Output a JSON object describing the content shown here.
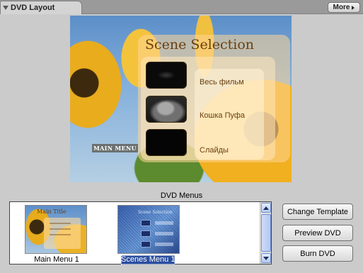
{
  "panel": {
    "title": "DVD Layout",
    "more_label": "More"
  },
  "preview": {
    "scene_title": "Scene Selection",
    "items": [
      {
        "label": "Весь фильм"
      },
      {
        "label": "Кошка Пуфа"
      },
      {
        "label": "Слайды"
      }
    ],
    "main_menu_label": "MAIN MENU"
  },
  "menus": {
    "heading": "DVD Menus",
    "items": [
      {
        "label": "Main Menu 1",
        "thumb_title": "Main Title",
        "selected": false
      },
      {
        "label": "Scenes Menu 1",
        "thumb_title": "Scene Selection",
        "selected": true
      }
    ]
  },
  "buttons": {
    "change_template": "Change Template",
    "preview_dvd": "Preview DVD",
    "burn_dvd": "Burn DVD"
  },
  "colors": {
    "background": "#cbcbcb",
    "selection": "#2a4d9e",
    "menu_text": "#6a3f10"
  }
}
